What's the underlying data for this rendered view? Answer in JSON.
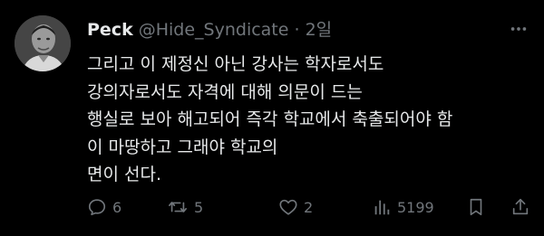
{
  "tweet": {
    "name": "Peck",
    "handle": "@Hide_Syndicate",
    "separator": "·",
    "time": "2일",
    "text_lines": [
      "그리고 이 제정신 아닌 강사는 학자로서도",
      "강의자로서도 자격에 대해 의문이 드는",
      "행실로 보아 해고되어 즉각 학교에서 축출되어야 함",
      "이 마땅하고 그래야 학교의",
      "면이 선다."
    ]
  },
  "actions": {
    "replies": "6",
    "reposts": "5",
    "likes": "2",
    "views": "5199"
  },
  "icons": {
    "more": "more-dots-icon",
    "reply": "reply-icon",
    "repost": "repost-icon",
    "like": "heart-icon",
    "views": "views-chart-icon",
    "bookmark": "bookmark-icon",
    "share": "share-icon"
  },
  "colors": {
    "background": "#000000",
    "text": "#e7e9ea",
    "muted": "#71767b"
  }
}
